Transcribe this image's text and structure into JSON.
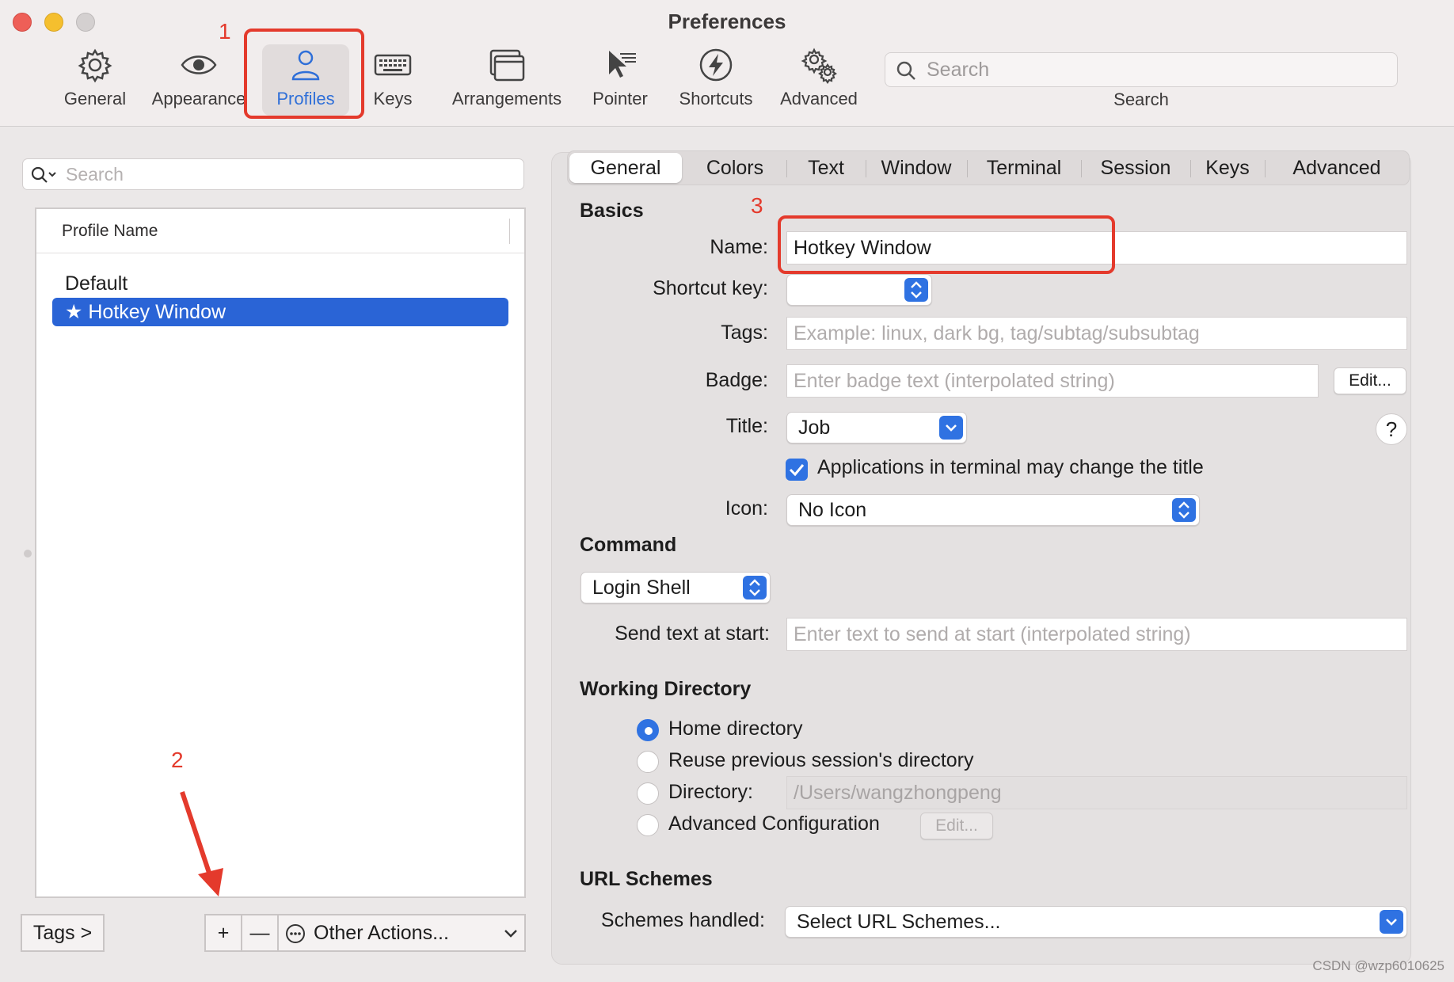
{
  "window": {
    "title": "Preferences"
  },
  "toolbar": {
    "items": [
      {
        "label": "General",
        "icon": "gear-icon"
      },
      {
        "label": "Appearance",
        "icon": "eye-icon"
      },
      {
        "label": "Profiles",
        "icon": "person-icon",
        "active": true
      },
      {
        "label": "Keys",
        "icon": "keyboard-icon"
      },
      {
        "label": "Arrangements",
        "icon": "windows-icon"
      },
      {
        "label": "Pointer",
        "icon": "pointer-icon"
      },
      {
        "label": "Shortcuts",
        "icon": "bolt-icon"
      },
      {
        "label": "Advanced",
        "icon": "gears-icon"
      }
    ],
    "search": {
      "placeholder": "Search",
      "label": "Search"
    }
  },
  "annotations": {
    "one": "1",
    "two": "2",
    "three": "3",
    "color": "#e43a2c"
  },
  "left": {
    "search_placeholder": "Search",
    "table_header": "Profile Name",
    "profiles": [
      {
        "name": "Default",
        "selected": false
      },
      {
        "name": "★ Hotkey Window",
        "selected": true
      }
    ],
    "tags_button": "Tags >",
    "add_button": "+",
    "remove_button": "—",
    "other_actions": "Other Actions...",
    "other_actions_icon": "ellipsis-circle-icon"
  },
  "tabs": [
    "General",
    "Colors",
    "Text",
    "Window",
    "Terminal",
    "Session",
    "Keys",
    "Advanced"
  ],
  "active_tab": "General",
  "basics": {
    "heading": "Basics",
    "name_label": "Name:",
    "name_value": "Hotkey Window",
    "shortcut_label": "Shortcut key:",
    "tags_label": "Tags:",
    "tags_placeholder": "Example: linux, dark bg, tag/subtag/subsubtag",
    "badge_label": "Badge:",
    "badge_placeholder": "Enter badge text (interpolated string)",
    "badge_edit": "Edit...",
    "title_label": "Title:",
    "title_value": "Job",
    "help": "?",
    "apps_change_title": "Applications in terminal may change the title",
    "apps_change_title_checked": true,
    "icon_label": "Icon:",
    "icon_value": "No Icon"
  },
  "command": {
    "heading": "Command",
    "shell_value": "Login Shell",
    "send_text_label": "Send text at start:",
    "send_text_placeholder": "Enter text to send at start (interpolated string)"
  },
  "working_directory": {
    "heading": "Working Directory",
    "options": [
      {
        "label": "Home directory",
        "selected": true
      },
      {
        "label": "Reuse previous session's directory",
        "selected": false
      },
      {
        "label": "Directory:",
        "selected": false
      },
      {
        "label": "Advanced Configuration",
        "selected": false
      }
    ],
    "directory_value": "/Users/wangzhongpeng",
    "advanced_edit": "Edit..."
  },
  "url_schemes": {
    "heading": "URL Schemes",
    "label": "Schemes handled:",
    "value": "Select URL Schemes..."
  },
  "watermark": "CSDN @wzp6010625",
  "colors": {
    "accent": "#2f72e2",
    "selection": "#2a64d6",
    "annotation": "#e43a2c"
  }
}
